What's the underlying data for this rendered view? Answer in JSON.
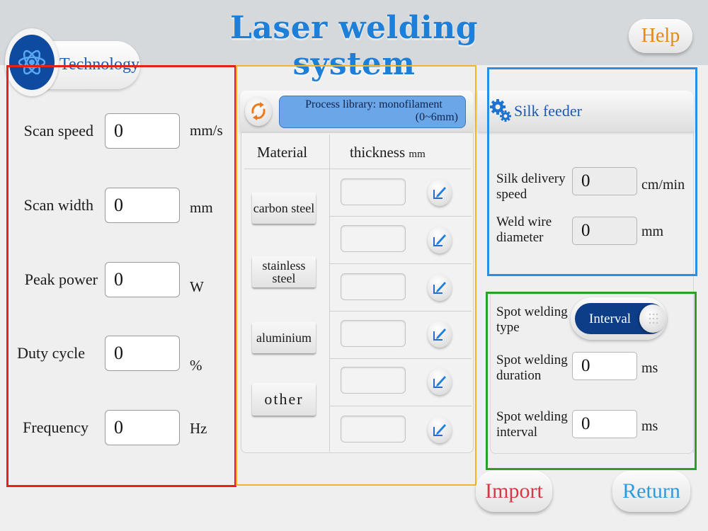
{
  "header": {
    "title": "Laser welding system",
    "help_label": "Help"
  },
  "colors": {
    "title": "#1e7fd8",
    "technology_frame": "#e2231a",
    "process_library_frame": "#f5b325",
    "silk_feeder_frame": "#2c8ee0",
    "spot_welding_frame": "#2aa02a",
    "help": "#e08a1e",
    "import": "#d43a46",
    "return": "#2c9ae0",
    "toggle_track": "#0d3d86"
  },
  "technology": {
    "tab_label": "Technology",
    "icon": "atom-icon",
    "params": [
      {
        "label": "Scan speed",
        "value": "0",
        "unit": "mm/s"
      },
      {
        "label": "Scan width",
        "value": "0",
        "unit": "mm"
      },
      {
        "label": "Peak power",
        "value": "0",
        "unit": "W"
      },
      {
        "label": "Duty cycle",
        "value": "0",
        "unit": "%"
      },
      {
        "label": "Frequency",
        "value": "0",
        "unit": "Hz"
      }
    ]
  },
  "process_library": {
    "refresh_icon": "refresh-icon",
    "title_line1": "Process library: monofilament",
    "title_line2": "(0~6mm)",
    "col_material": "Material",
    "col_thickness": "thickness",
    "col_thickness_unit": "mm",
    "materials": [
      "carbon steel",
      "stainless steel",
      "aluminium",
      "other"
    ],
    "thickness_rows": [
      {
        "value": "",
        "edit_icon": "edit-icon"
      },
      {
        "value": "",
        "edit_icon": "edit-icon"
      },
      {
        "value": "",
        "edit_icon": "edit-icon"
      },
      {
        "value": "",
        "edit_icon": "edit-icon"
      },
      {
        "value": "",
        "edit_icon": "edit-icon"
      },
      {
        "value": "",
        "edit_icon": "edit-icon"
      }
    ]
  },
  "silk_feeder": {
    "title": "Silk feeder",
    "icon": "gear-icon",
    "delivery_speed_label_1": "Silk delivery",
    "delivery_speed_label_2": "speed",
    "delivery_speed_value": "0",
    "delivery_speed_unit": "cm/min",
    "wire_diameter_label_1": "Weld wire",
    "wire_diameter_label_2": "diameter",
    "wire_diameter_value": "0",
    "wire_diameter_unit": "mm"
  },
  "spot_welding": {
    "type_label_1": "Spot welding",
    "type_label_2": "type",
    "type_value": "Interval",
    "duration_label_1": "Spot welding",
    "duration_label_2": "duration",
    "duration_value": "0",
    "duration_unit": "ms",
    "interval_label_1": "Spot welding",
    "interval_label_2": "interval",
    "interval_value": "0",
    "interval_unit": "ms"
  },
  "footer": {
    "import_label": "Import",
    "return_label": "Return"
  }
}
